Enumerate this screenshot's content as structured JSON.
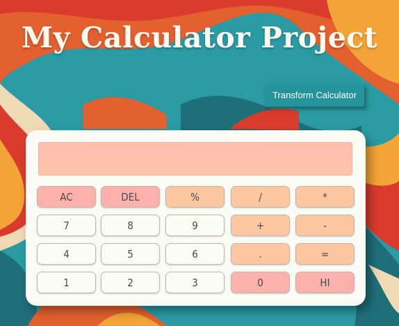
{
  "header": {
    "title": "My Calculator Project"
  },
  "toolbar": {
    "transform_label": "Transform Calculator"
  },
  "display": {
    "value": ""
  },
  "keys": {
    "ac": "AC",
    "del": "DEL",
    "percent": "%",
    "divide": "/",
    "multiply": "*",
    "seven": "7",
    "eight": "8",
    "nine": "9",
    "plus": "+",
    "minus": "-",
    "four": "4",
    "five": "5",
    "six": "6",
    "dot": ".",
    "equals": "=",
    "one": "1",
    "two": "2",
    "three": "3",
    "zero": "0",
    "hi": "HI"
  },
  "colors": {
    "accent_red": "#fdb1ad",
    "accent_orange": "#fdc7a2",
    "button_teal": "#25949a",
    "panel": "#fbfbf6"
  }
}
